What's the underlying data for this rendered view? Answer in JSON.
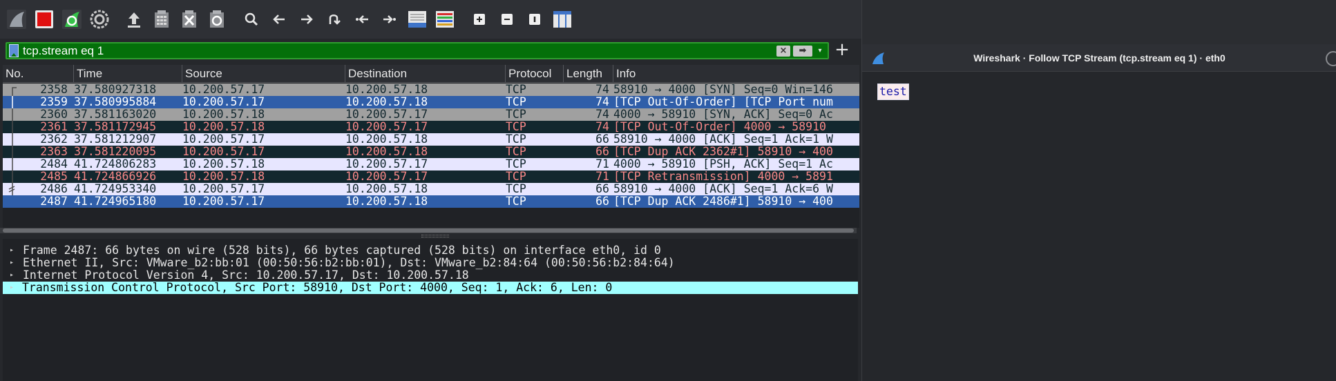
{
  "filter": {
    "value": "tcp.stream eq 1",
    "clear_icon": "clear-filter-icon",
    "apply_icon": "apply-filter-arrow-icon",
    "add_label": "+"
  },
  "toolbar_icons": [
    "shark-fin-start-icon",
    "stop-capture-icon",
    "restart-capture-icon",
    "capture-options-icon",
    "open-file-icon",
    "save-file-icon",
    "close-file-icon",
    "reload-file-icon",
    "find-packet-icon",
    "go-back-icon",
    "go-forward-icon",
    "go-to-packet-icon",
    "go-first-icon",
    "go-last-icon",
    "auto-scroll-icon",
    "colorize-icon",
    "zoom-in-icon",
    "zoom-out-icon",
    "normal-size-icon",
    "resize-columns-icon"
  ],
  "packet_list": {
    "columns": [
      "No.",
      "Time",
      "Source",
      "Destination",
      "Protocol",
      "Length",
      "Info"
    ],
    "rows": [
      {
        "no": "2358",
        "time": "37.580927318",
        "src": "10.200.57.17",
        "dst": "10.200.57.18",
        "proto": "TCP",
        "len": "74",
        "info": "58910 → 4000 [SYN] Seq=0 Win=146",
        "style": "gray",
        "tree": "start"
      },
      {
        "no": "2359",
        "time": "37.580995884",
        "src": "10.200.57.17",
        "dst": "10.200.57.18",
        "proto": "TCP",
        "len": "74",
        "info": "[TCP Out-Of-Order] [TCP Port num",
        "style": "selected",
        "tree": "mid"
      },
      {
        "no": "2360",
        "time": "37.581163020",
        "src": "10.200.57.18",
        "dst": "10.200.57.17",
        "proto": "TCP",
        "len": "74",
        "info": "4000 → 58910 [SYN, ACK] Seq=0 Ac",
        "style": "gray",
        "tree": "mid"
      },
      {
        "no": "2361",
        "time": "37.581172945",
        "src": "10.200.57.18",
        "dst": "10.200.57.17",
        "proto": "TCP",
        "len": "74",
        "info": "[TCP Out-Of-Order] 4000 → 58910",
        "style": "bad",
        "tree": "mid"
      },
      {
        "no": "2362",
        "time": "37.581212907",
        "src": "10.200.57.17",
        "dst": "10.200.57.18",
        "proto": "TCP",
        "len": "66",
        "info": "58910 → 4000 [ACK] Seq=1 Ack=1 W",
        "style": "light",
        "tree": "mid"
      },
      {
        "no": "2363",
        "time": "37.581220095",
        "src": "10.200.57.17",
        "dst": "10.200.57.18",
        "proto": "TCP",
        "len": "66",
        "info": "[TCP Dup ACK 2362#1] 58910 → 400",
        "style": "bad",
        "tree": "mid"
      },
      {
        "no": "2484",
        "time": "41.724806283",
        "src": "10.200.57.18",
        "dst": "10.200.57.17",
        "proto": "TCP",
        "len": "71",
        "info": "4000 → 58910 [PSH, ACK] Seq=1 Ac",
        "style": "light",
        "tree": "mid"
      },
      {
        "no": "2485",
        "time": "41.724866926",
        "src": "10.200.57.18",
        "dst": "10.200.57.17",
        "proto": "TCP",
        "len": "71",
        "info": "[TCP Retransmission] 4000 → 5891",
        "style": "bad",
        "tree": "mid"
      },
      {
        "no": "2486",
        "time": "41.724953340",
        "src": "10.200.57.17",
        "dst": "10.200.57.18",
        "proto": "TCP",
        "len": "66",
        "info": "58910 → 4000 [ACK] Seq=1 Ack=6 W",
        "style": "light",
        "tree": "ack"
      },
      {
        "no": "2487",
        "time": "41.724965180",
        "src": "10.200.57.17",
        "dst": "10.200.57.18",
        "proto": "TCP",
        "len": "66",
        "info": "[TCP Dup ACK 2486#1] 58910 → 400",
        "style": "selected",
        "tree": "none"
      }
    ]
  },
  "details": [
    {
      "text": "Frame 2487: 66 bytes on wire (528 bits), 66 bytes captured (528 bits) on interface eth0, id 0",
      "selected": false
    },
    {
      "text": "Ethernet II, Src: VMware_b2:bb:01 (00:50:56:b2:bb:01), Dst: VMware_b2:84:64 (00:50:56:b2:84:64)",
      "selected": false
    },
    {
      "text": "Internet Protocol Version 4, Src: 10.200.57.17, Dst: 10.200.57.18",
      "selected": false
    },
    {
      "text": "Transmission Control Protocol, Src Port: 58910, Dst Port: 4000, Seq: 1, Ack: 6, Len: 0",
      "selected": true
    }
  ],
  "stream_window": {
    "title": "Wireshark · Follow TCP Stream (tcp.stream eq 1) · eth0",
    "content": "test"
  },
  "colors": {
    "gray_row_bg": "#a0a0a0",
    "gray_row_fg": "#12272e",
    "selected_row_bg": "#2f5ea9",
    "selected_row_fg": "#ffffff",
    "bad_row_bg": "#12272e",
    "bad_row_fg": "#f78787",
    "light_row_bg": "#e7e6ff",
    "light_row_fg": "#12272e",
    "filter_ok": "#04700a",
    "detail_selected": "#a0ffff"
  }
}
